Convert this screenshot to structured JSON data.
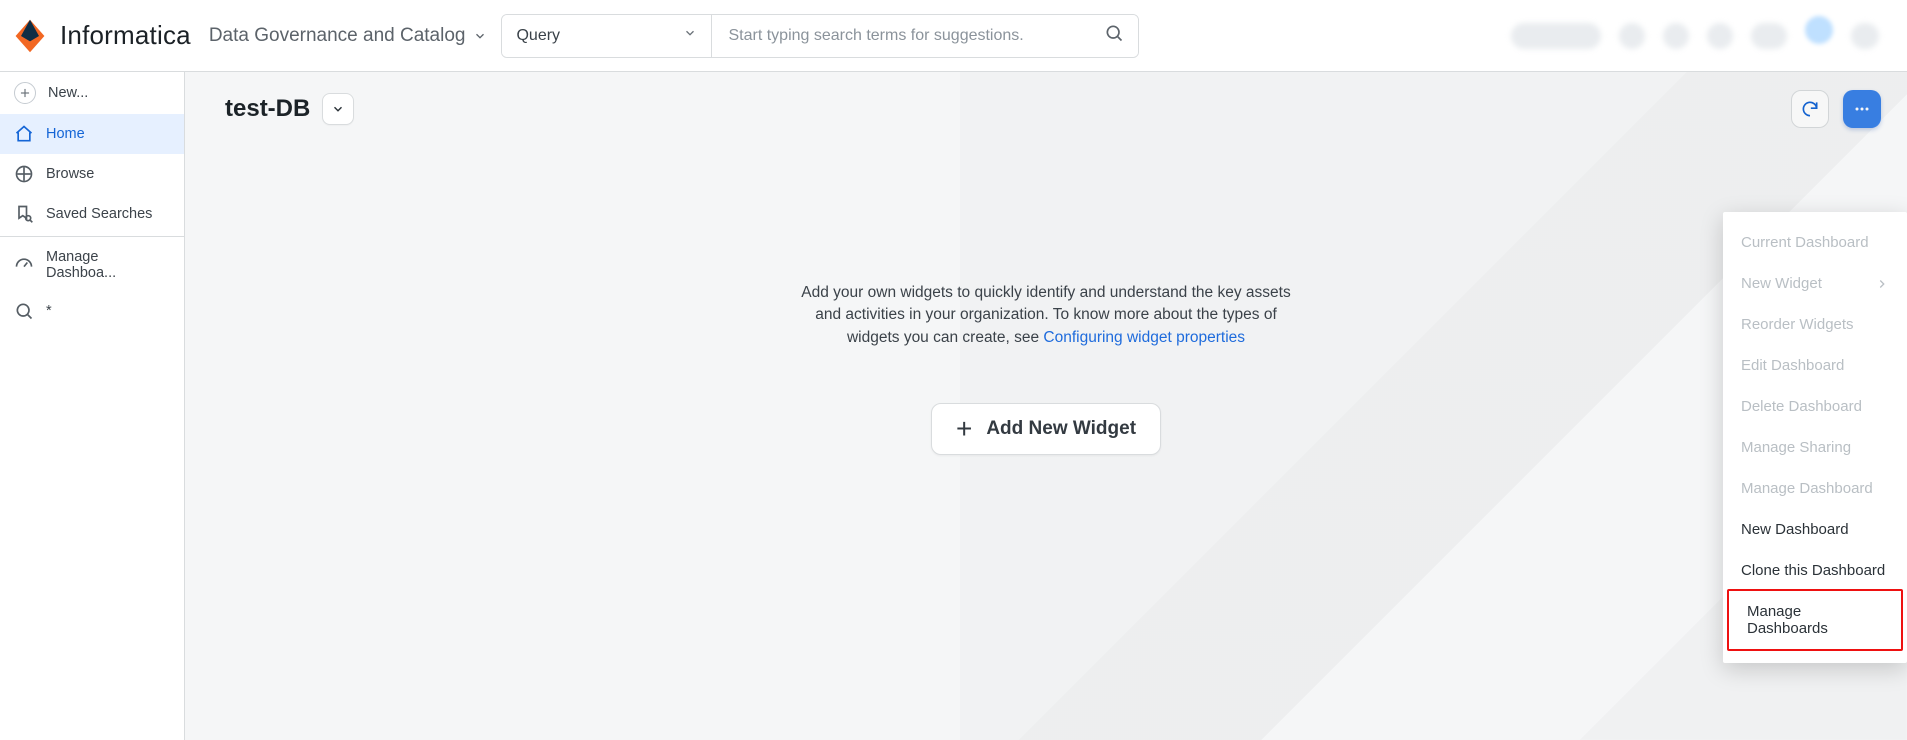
{
  "brand": {
    "name": "Informatica",
    "module": "Data Governance and Catalog"
  },
  "search": {
    "scope_label": "Query",
    "placeholder": "Start typing search terms for suggestions."
  },
  "sidebar": {
    "new_label": "New...",
    "items": [
      {
        "label": "Home"
      },
      {
        "label": "Browse"
      },
      {
        "label": "Saved Searches"
      }
    ],
    "manage_dashboards_label": "Manage Dashboa...",
    "search_row_label": "*"
  },
  "page": {
    "title": "test-DB"
  },
  "empty_state": {
    "line1": "Add your own widgets to quickly identify and understand the key assets",
    "line2_pre": "and activities in your organization. To know more about the types of",
    "line3_pre": "widgets you can create, see ",
    "link_label": "Configuring widget properties",
    "button_label": "Add New Widget"
  },
  "menu": {
    "items": [
      {
        "label": "Current Dashboard",
        "disabled": true,
        "sub": false
      },
      {
        "label": "New Widget",
        "disabled": true,
        "sub": true
      },
      {
        "label": "Reorder Widgets",
        "disabled": true,
        "sub": false
      },
      {
        "label": "Edit Dashboard",
        "disabled": true,
        "sub": false
      },
      {
        "label": "Delete Dashboard",
        "disabled": true,
        "sub": false
      },
      {
        "label": "Manage Sharing",
        "disabled": true,
        "sub": false
      },
      {
        "label": "Manage Dashboard",
        "disabled": true,
        "sub": false
      },
      {
        "label": "New Dashboard",
        "disabled": false,
        "sub": false
      },
      {
        "label": "Clone this Dashboard",
        "disabled": false,
        "sub": false
      },
      {
        "label": "Manage Dashboards",
        "disabled": false,
        "sub": false,
        "highlight": true
      }
    ]
  }
}
